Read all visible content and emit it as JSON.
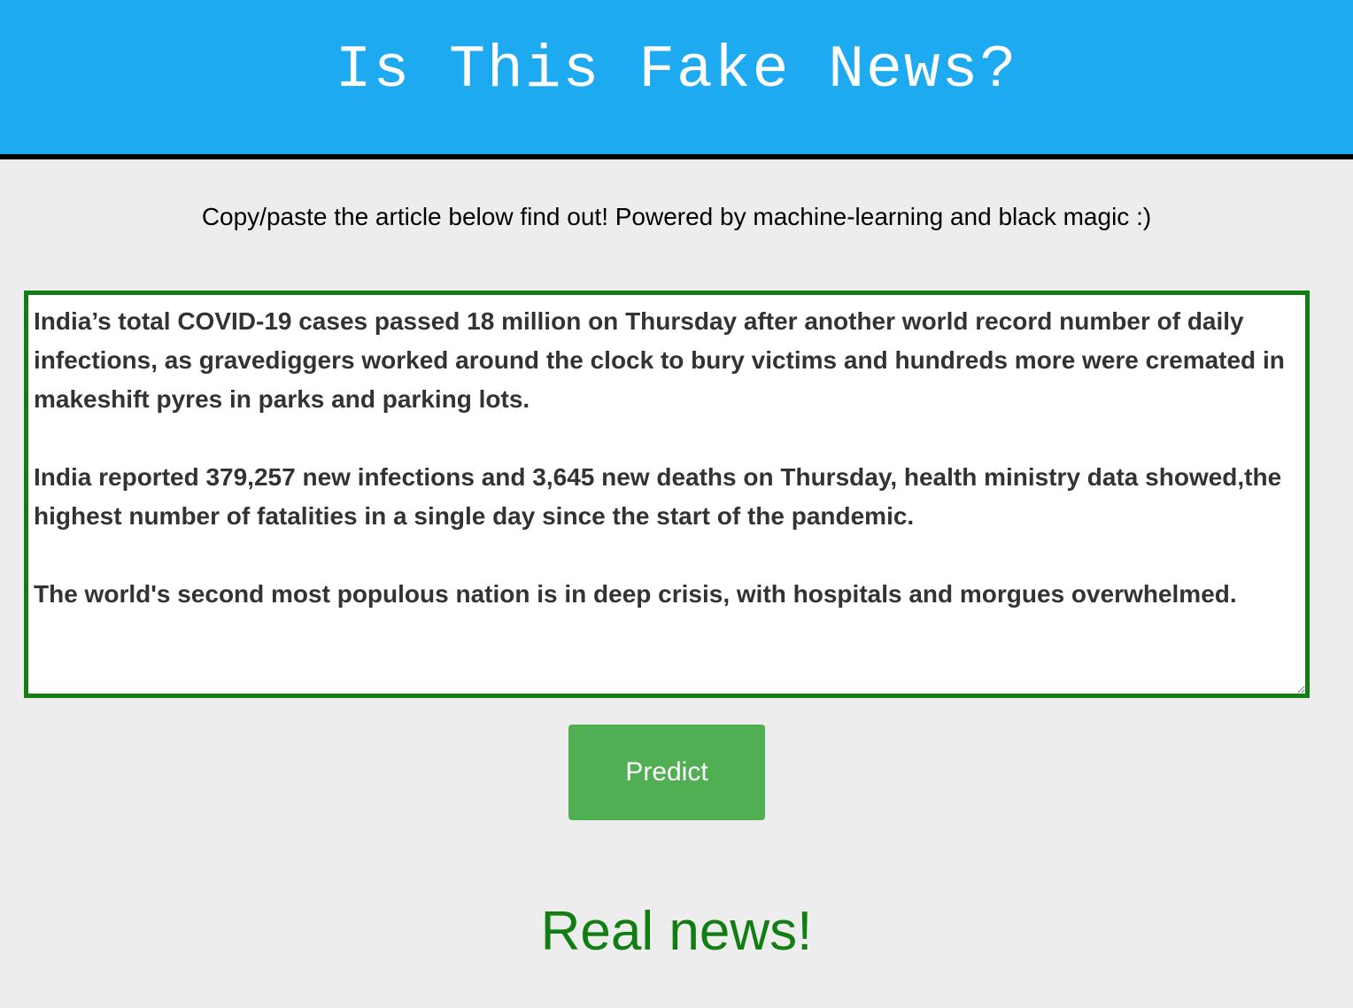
{
  "header": {
    "title": "Is This Fake News?"
  },
  "subtitle": "Copy/paste the article below find out! Powered by machine-learning and black magic :)",
  "article": {
    "value": "India’s total COVID-19 cases passed 18 million on Thursday after another world record number of daily infections, as gravediggers worked around the clock to bury victims and hundreds more were cremated in makeshift pyres in parks and parking lots.\n\nIndia reported 379,257 new infections and 3,645 new deaths on Thursday, health ministry data showed,the highest number of fatalities in a single day since the start of the pandemic.\n\nThe world's second most populous nation is in deep crisis, with hospitals and morgues overwhelmed."
  },
  "predict_button": {
    "label": "Predict"
  },
  "result": {
    "text": "Real news!"
  },
  "colors": {
    "header_bg": "#1eaaf1",
    "page_bg": "#ededed",
    "input_border": "#117d12",
    "button_bg": "#51af53",
    "result_text": "#117d12"
  }
}
